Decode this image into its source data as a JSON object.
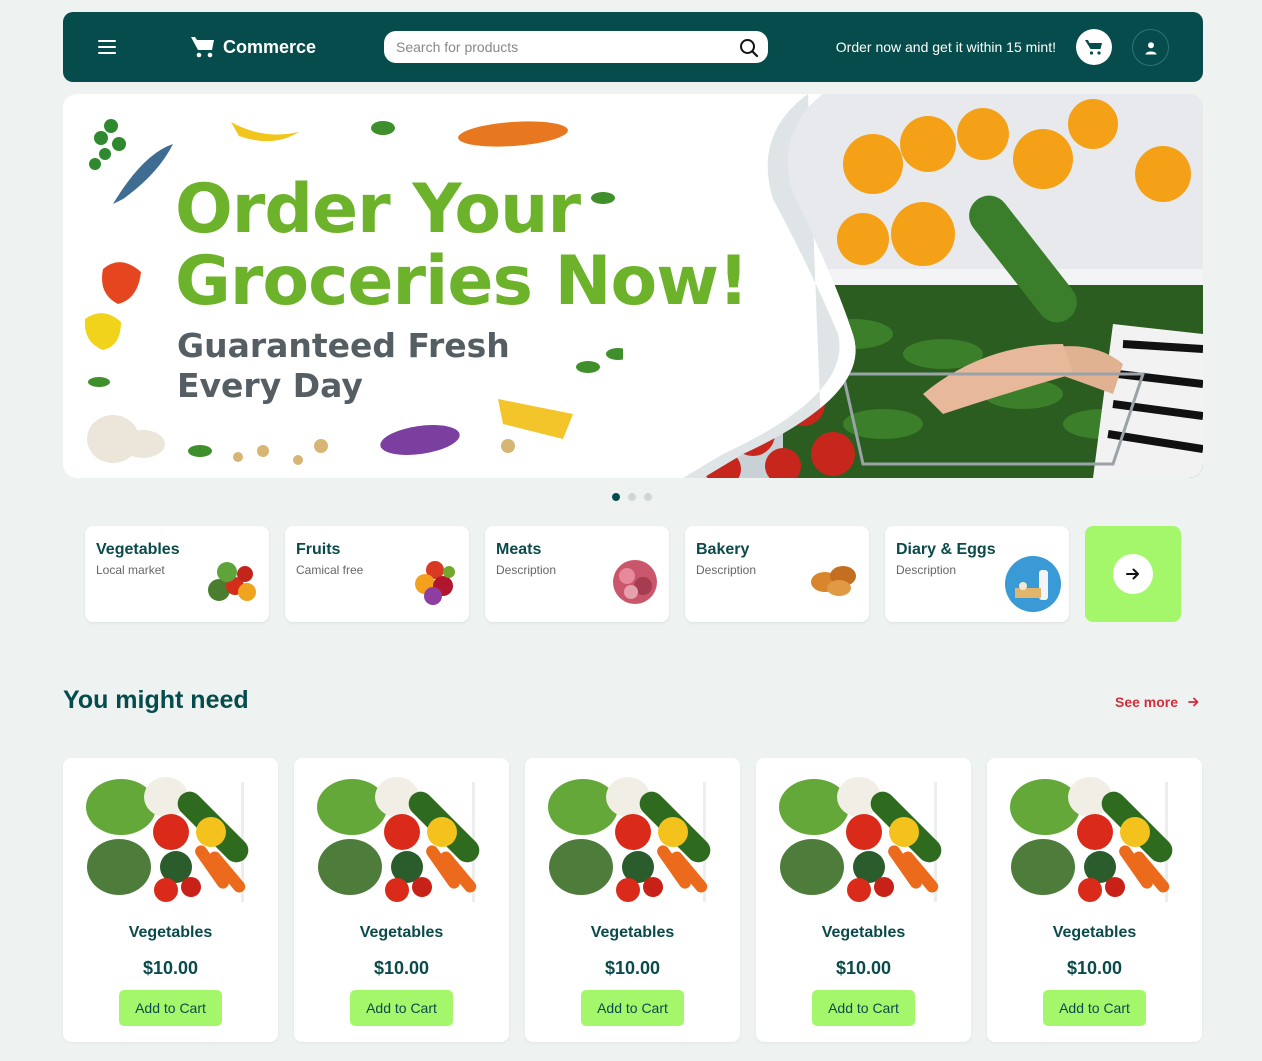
{
  "header": {
    "logo_text": "Commerce",
    "search_placeholder": "Search for products",
    "promo": "Order now and get it within 15 mint!"
  },
  "hero": {
    "title_line1": "Order Your",
    "title_line2": "Groceries Now!",
    "subtitle_line1": "Guaranteed Fresh",
    "subtitle_line2": "Every Day",
    "slides": 3,
    "active_slide": 1
  },
  "categories": [
    {
      "name": "Vegetables",
      "desc": "Local market"
    },
    {
      "name": "Fruits",
      "desc": "Camical free"
    },
    {
      "name": "Meats",
      "desc": "Description"
    },
    {
      "name": "Bakery",
      "desc": "Description"
    },
    {
      "name": "Diary & Eggs",
      "desc": "Description"
    }
  ],
  "section": {
    "title": "You might need",
    "see_more": "See more"
  },
  "products": [
    {
      "name": "Vegetables",
      "price": "$10.00",
      "button": "Add to Cart"
    },
    {
      "name": "Vegetables",
      "price": "$10.00",
      "button": "Add to Cart"
    },
    {
      "name": "Vegetables",
      "price": "$10.00",
      "button": "Add to Cart"
    },
    {
      "name": "Vegetables",
      "price": "$10.00",
      "button": "Add to Cart"
    },
    {
      "name": "Vegetables",
      "price": "$10.00",
      "button": "Add to Cart"
    }
  ],
  "colors": {
    "primary": "#064c4c",
    "accent": "#a4f76b",
    "link": "#d42d3c",
    "hero_green": "#6cb22a"
  }
}
